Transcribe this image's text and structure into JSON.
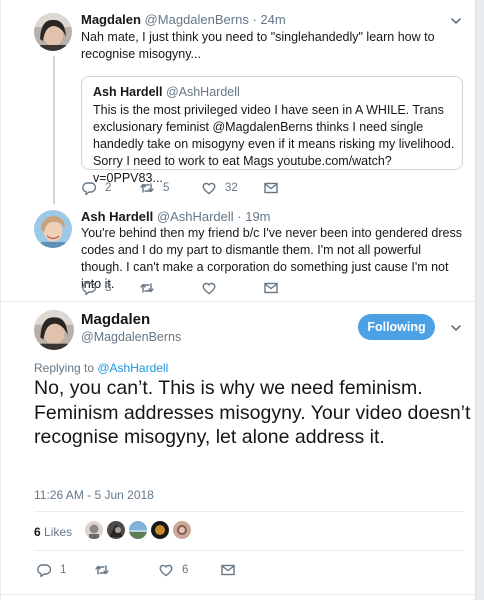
{
  "tweet1": {
    "name": "Magdalen",
    "handle": "@MagdalenBerns",
    "time": "· 24m",
    "text": "Nah mate, I just think you need to \"singlehandedly\" learn how to recognise misogyny...",
    "quote": {
      "name": "Ash Hardell",
      "handle": "@AshHardell",
      "text": "This is the most privileged video I have seen in A WHILE. Trans exclusionary feminist @MagdalenBerns thinks I need single handedly take on misogyny even if it means risking my livelihood. Sorry I need to work to eat Mags youtube.com/watch?v=0PPV83..."
    },
    "actions": {
      "replies": "2",
      "retweets": "5",
      "likes": "32"
    }
  },
  "tweet2": {
    "name": "Ash Hardell",
    "handle": "@AshHardell",
    "time": "· 19m",
    "text": "You're behind then my friend b/c I've never been into gendered dress codes and I do my part to dismantle them. I'm not all powerful though. I can't make a corporation do something just cause I'm not into it.",
    "actions": {
      "replies": "3",
      "retweets": "",
      "likes": ""
    }
  },
  "main": {
    "name": "Magdalen",
    "handle": "@MagdalenBerns",
    "follow_label": "Following",
    "replying_prefix": "Replying to ",
    "replying_handle": "@AshHardell",
    "text": "No, you can’t. This is why we need feminism. Feminism addresses misogyny. Your video doesn’t recognise misogyny, let alone address it.",
    "timestamp": "11:26 AM - 5 Jun 2018",
    "likes_count": "6",
    "likes_label": " Likes",
    "actions": {
      "replies": "1",
      "retweets": "",
      "likes": "6"
    }
  },
  "colors": {
    "accent": "#1da1f2",
    "follow_button": "#4ca1e4",
    "secondary_text": "#657786",
    "thread_line": "#ccd6dd"
  },
  "icons": [
    "reply-icon",
    "retweet-icon",
    "like-icon",
    "message-icon",
    "chevron-down-icon"
  ]
}
